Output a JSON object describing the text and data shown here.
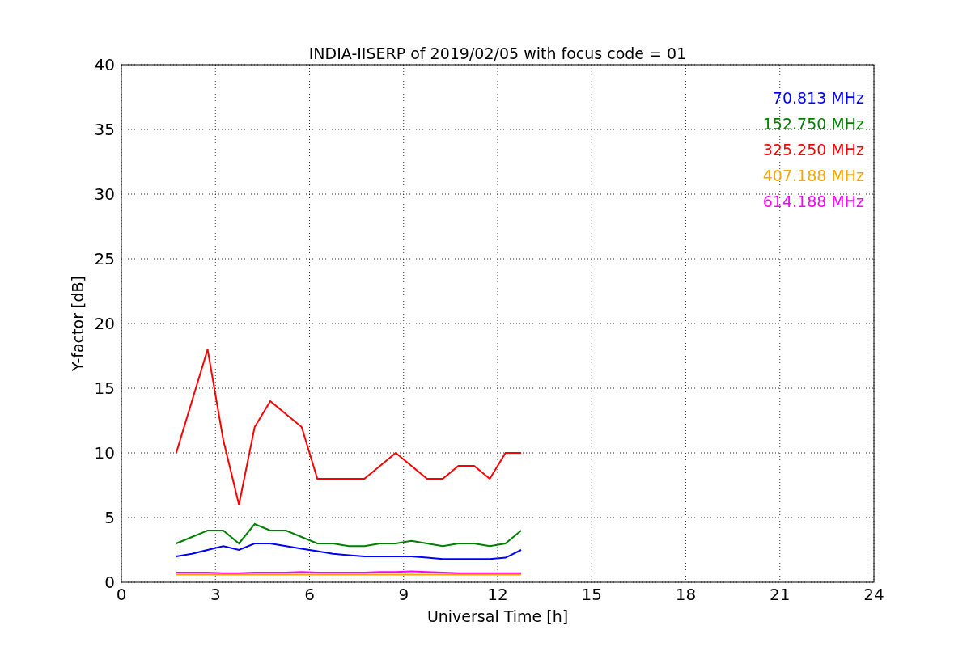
{
  "chart_data": {
    "type": "line",
    "title": "INDIA-IISERP of 2019/02/05 with focus code = 01",
    "xlabel": "Universal Time [h]",
    "ylabel": "Y-factor [dB]",
    "xlim": [
      0,
      24
    ],
    "ylim": [
      0,
      40
    ],
    "xticks": [
      0,
      3,
      6,
      9,
      12,
      15,
      18,
      21,
      24
    ],
    "yticks": [
      0,
      5,
      10,
      15,
      20,
      25,
      30,
      35,
      40
    ],
    "grid": true,
    "x": [
      1.75,
      2.25,
      2.75,
      3.25,
      3.75,
      4.25,
      4.75,
      5.25,
      5.75,
      6.25,
      6.75,
      7.25,
      7.75,
      8.25,
      8.75,
      9.25,
      9.75,
      10.25,
      10.75,
      11.25,
      11.75,
      12.25,
      12.75
    ],
    "series": [
      {
        "name": "70.813 MHz",
        "color": "#0000ff",
        "values": [
          2,
          2.2,
          2.5,
          2.8,
          2.5,
          3,
          3,
          2.8,
          2.6,
          2.4,
          2.2,
          2.1,
          2,
          2,
          2,
          2,
          1.9,
          1.8,
          1.8,
          1.8,
          1.8,
          1.9,
          2.5
        ]
      },
      {
        "name": "152.750 MHz",
        "color": "#008000",
        "values": [
          3,
          3.5,
          4,
          4,
          3,
          4.5,
          4,
          4,
          3.5,
          3,
          3,
          2.8,
          2.8,
          3,
          3,
          3.2,
          3,
          2.8,
          3,
          3,
          2.8,
          3,
          4
        ]
      },
      {
        "name": "325.250 MHz",
        "color": "#ff0000",
        "values": [
          10,
          14,
          18,
          11,
          6,
          12,
          14,
          13,
          12,
          8,
          8,
          8,
          8,
          9,
          10,
          9,
          8,
          8,
          9,
          9,
          8,
          10,
          10
        ]
      },
      {
        "name": "407.188 MHz",
        "color": "#ffa500",
        "values": [
          0.6,
          0.6,
          0.6,
          0.6,
          0.6,
          0.6,
          0.6,
          0.6,
          0.6,
          0.6,
          0.6,
          0.6,
          0.6,
          0.6,
          0.6,
          0.6,
          0.6,
          0.6,
          0.6,
          0.6,
          0.6,
          0.6,
          0.6
        ]
      },
      {
        "name": "614.188 MHz",
        "color": "#ff00ff",
        "values": [
          0.75,
          0.75,
          0.75,
          0.7,
          0.7,
          0.75,
          0.75,
          0.75,
          0.8,
          0.75,
          0.75,
          0.75,
          0.75,
          0.8,
          0.8,
          0.85,
          0.8,
          0.75,
          0.7,
          0.7,
          0.7,
          0.7,
          0.7
        ]
      }
    ]
  }
}
